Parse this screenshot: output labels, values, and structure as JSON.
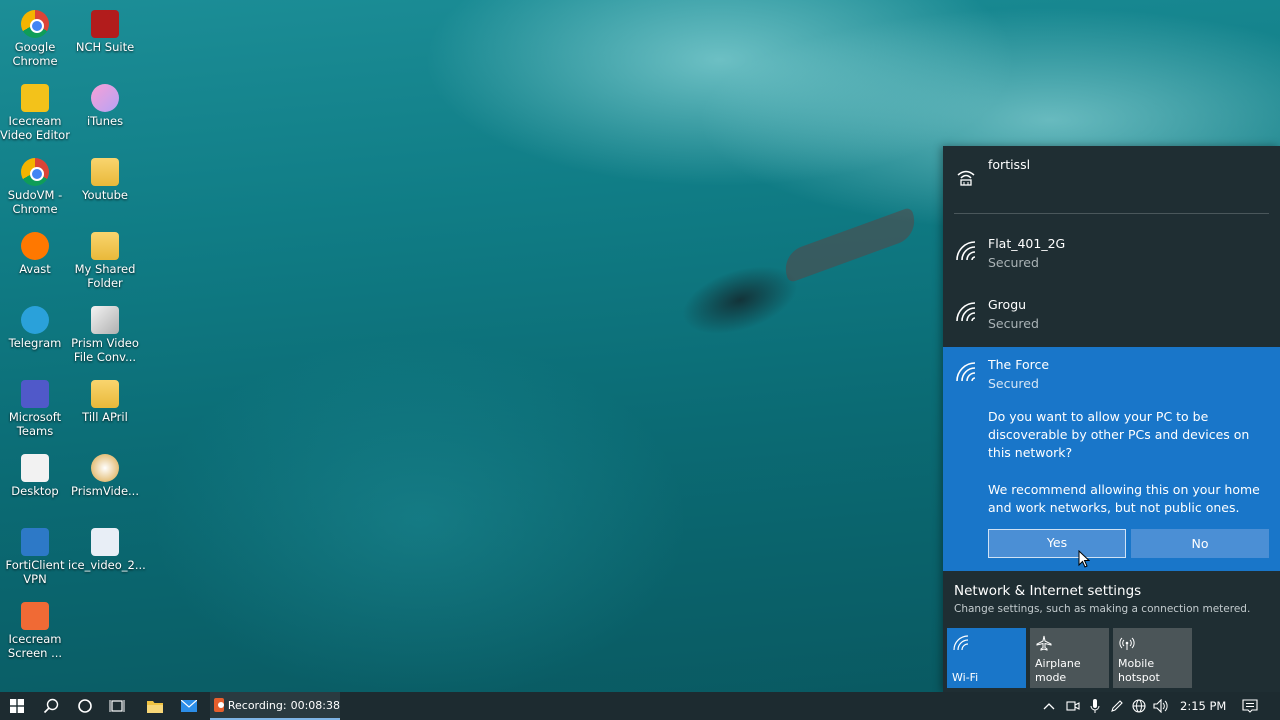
{
  "desktop": {
    "icons": [
      {
        "label": "Google Chrome",
        "icon": "chrome-icon"
      },
      {
        "label": "NCH Suite",
        "icon": "nch-suite-icon"
      },
      {
        "label": "Icecream Video Editor",
        "icon": "icecream-video-editor-icon"
      },
      {
        "label": "iTunes",
        "icon": "itunes-icon"
      },
      {
        "label": "SudoVM - Chrome",
        "icon": "chrome-icon"
      },
      {
        "label": "Youtube",
        "icon": "folder-icon"
      },
      {
        "label": "Avast",
        "icon": "avast-icon"
      },
      {
        "label": "My Shared Folder",
        "icon": "folder-icon"
      },
      {
        "label": "Telegram",
        "icon": "telegram-icon"
      },
      {
        "label": "Prism Video File Conv...",
        "icon": "prism-icon"
      },
      {
        "label": "Microsoft Teams",
        "icon": "teams-icon"
      },
      {
        "label": "Till APril",
        "icon": "folder-icon"
      },
      {
        "label": "Desktop",
        "icon": "folder-icon"
      },
      {
        "label": "PrismVide...",
        "icon": "prism-icon"
      },
      {
        "label": "FortiClient VPN",
        "icon": "forticlient-icon"
      },
      {
        "label": "ice_video_2...",
        "icon": "video-file-icon"
      },
      {
        "label": "Icecream Screen ...",
        "icon": "icecream-screen-recorder-icon"
      }
    ]
  },
  "network": {
    "connected": {
      "name": "fortissl"
    },
    "list": [
      {
        "name": "Flat_401_2G",
        "status": "Secured"
      },
      {
        "name": "Grogu",
        "status": "Secured"
      }
    ],
    "selected": {
      "name": "The Force",
      "status": "Secured",
      "prompt": "Do you want to allow your PC to be discoverable by other PCs and devices on this network?",
      "recommend": "We recommend allowing this on your home and work networks, but not public ones.",
      "yes_label": "Yes",
      "no_label": "No"
    },
    "settings_title": "Network & Internet settings",
    "settings_sub": "Change settings, such as making a connection metered.",
    "tiles": [
      {
        "label": "Wi-Fi",
        "icon": "wifi-icon",
        "active": true
      },
      {
        "label": "Airplane mode",
        "icon": "airplane-icon",
        "active": false
      },
      {
        "label": "Mobile hotspot",
        "icon": "hotspot-icon",
        "active": false
      }
    ]
  },
  "taskbar": {
    "recording_label": "Recording:",
    "recording_time": "00:08:38",
    "clock": "2:15 PM"
  },
  "colors": {
    "flyout_bg": "#1f2e33",
    "accent": "#1976c9",
    "taskbar_bg": "#1d2b30"
  }
}
